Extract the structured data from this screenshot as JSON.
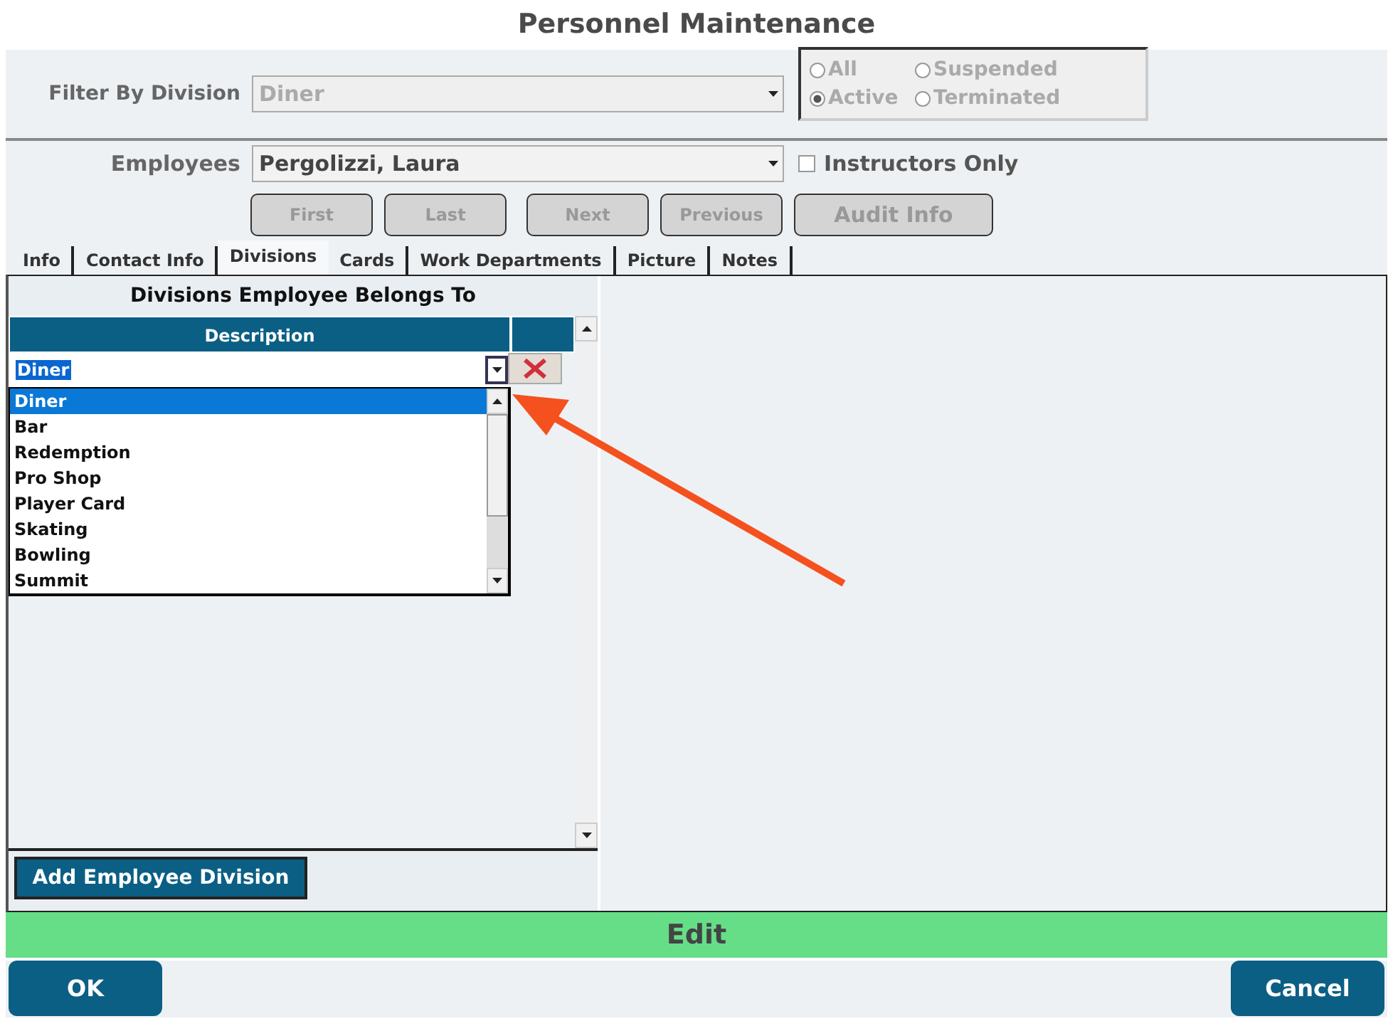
{
  "window": {
    "title": "Personnel Maintenance"
  },
  "filter": {
    "label": "Filter By Division",
    "value": "Diner",
    "disabled": true
  },
  "status_options": [
    {
      "label": "All",
      "selected": false
    },
    {
      "label": "Suspended",
      "selected": false
    },
    {
      "label": "Active",
      "selected": true
    },
    {
      "label": "Terminated",
      "selected": false
    }
  ],
  "employees": {
    "label": "Employees",
    "value": "Pergolizzi, Laura"
  },
  "instructors_only": {
    "label": "Instructors Only",
    "checked": false
  },
  "nav_buttons": [
    {
      "label": "First",
      "disabled": true
    },
    {
      "label": "Last",
      "disabled": true
    },
    {
      "label": "Next",
      "disabled": true
    },
    {
      "label": "Previous",
      "disabled": true
    },
    {
      "label": "Audit Info",
      "disabled": true
    }
  ],
  "tabs": [
    {
      "label": "Info",
      "selected": false
    },
    {
      "label": "Contact Info",
      "selected": false
    },
    {
      "label": "Divisions",
      "selected": true
    },
    {
      "label": "Cards",
      "selected": false
    },
    {
      "label": "Work Departments",
      "selected": false
    },
    {
      "label": "Picture",
      "selected": false
    },
    {
      "label": "Notes",
      "selected": false
    }
  ],
  "divisions": {
    "title": "Divisions Employee Belongs To",
    "column": "Description",
    "editor_value": "Diner",
    "items": [
      {
        "label": "Diner",
        "selected": true
      },
      {
        "label": "Bar",
        "selected": false
      },
      {
        "label": "Redemption",
        "selected": false
      },
      {
        "label": "Pro Shop",
        "selected": false
      },
      {
        "label": "Player Card",
        "selected": false
      },
      {
        "label": "Skating",
        "selected": false
      },
      {
        "label": "Bowling",
        "selected": false
      },
      {
        "label": "Summit",
        "selected": false
      }
    ]
  },
  "add_button": "Add Employee Division",
  "mode": "Edit",
  "buttons": [
    "OK",
    "Cancel"
  ]
}
